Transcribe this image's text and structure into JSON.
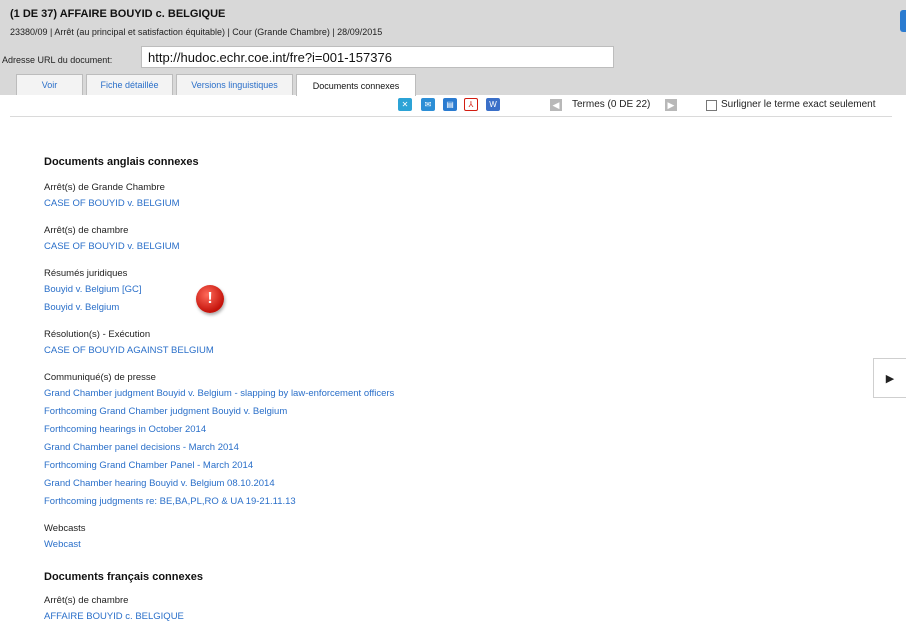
{
  "header": {
    "title": "(1 DE 37) AFFAIRE BOUYID c. BELGIQUE",
    "meta": "23380/09  |  Arrêt (au principal et satisfaction équitable)  |  Cour (Grande Chambre)  |  28/09/2015",
    "url_label": "Adresse URL du document:",
    "url_value": "http://hudoc.echr.coe.int/fre?i=001-157376"
  },
  "tabs": [
    {
      "label": "Voir"
    },
    {
      "label": "Fiche détaillée"
    },
    {
      "label": "Versions linguistiques"
    },
    {
      "label": "Documents connexes"
    }
  ],
  "toolbar": {
    "terms": "Termes (0 DE 22)",
    "exact_label": "Surligner le terme exact seulement",
    "icons": [
      "expand-icon",
      "email-icon",
      "print-icon",
      "pdf-icon",
      "word-icon"
    ]
  },
  "content": {
    "english_title": "Documents anglais connexes",
    "groups": [
      {
        "label": "Arrêt(s) de Grande Chambre",
        "links": [
          "CASE OF BOUYID v. BELGIUM"
        ]
      },
      {
        "label": "Arrêt(s) de chambre",
        "links": [
          "CASE OF BOUYID v. BELGIUM"
        ]
      },
      {
        "label": "Résumés juridiques",
        "links": [
          "Bouyid v. Belgium [GC]",
          "Bouyid v. Belgium"
        ]
      },
      {
        "label": "Résolution(s) - Exécution",
        "links": [
          "CASE OF BOUYID AGAINST BELGIUM"
        ]
      },
      {
        "label": "Communiqué(s) de presse",
        "links": [
          "Grand Chamber judgment Bouyid v. Belgium - slapping by law-enforcement officers",
          "Forthcoming Grand Chamber judgment Bouyid v. Belgium",
          "Forthcoming hearings in October 2014",
          "Grand Chamber panel decisions - March 2014",
          "Forthcoming Grand Chamber Panel - March 2014",
          "Grand Chamber hearing Bouyid v. Belgium 08.10.2014",
          "Forthcoming judgments re: BE,BA,PL,RO & UA 19-21.11.13"
        ]
      },
      {
        "label": "Webcasts",
        "links": [
          "Webcast"
        ]
      }
    ],
    "french_title": "Documents français connexes",
    "french_groups": [
      {
        "label": "Arrêt(s) de chambre",
        "links": [
          "AFFAIRE BOUYID c. BELGIQUE"
        ]
      }
    ]
  },
  "colors": {
    "header_bg": "#d8d8d8",
    "link": "#2a6fc9",
    "warning": "#d21c10",
    "accent": "#2b7bd0"
  }
}
